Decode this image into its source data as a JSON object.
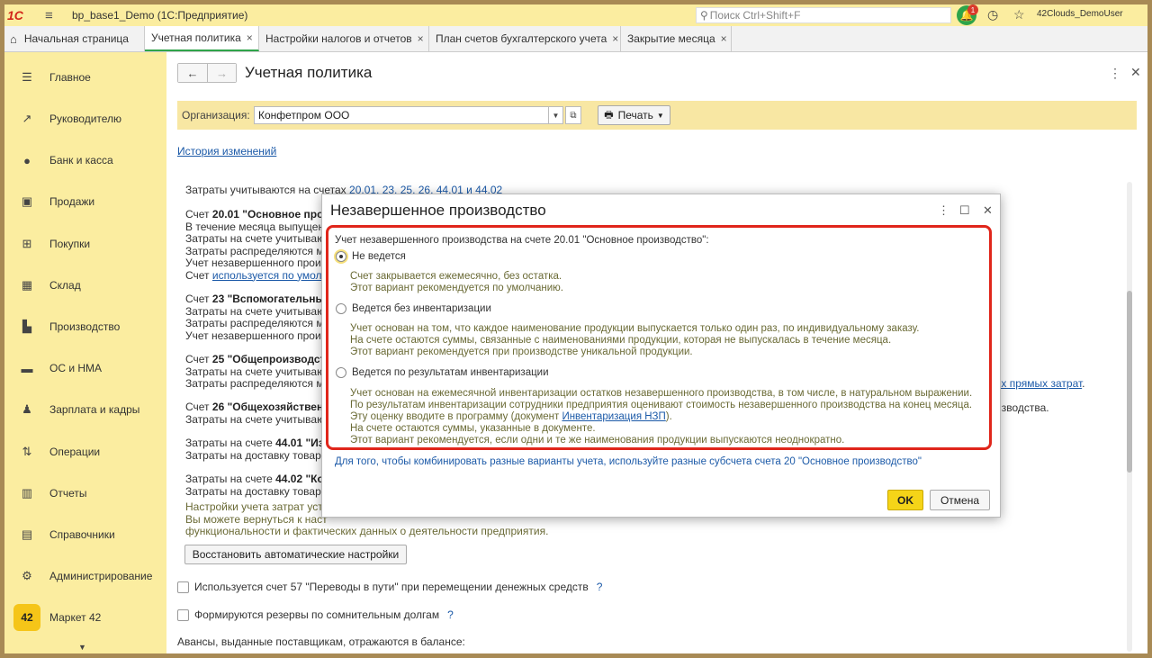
{
  "titlebar": {
    "logo": "1С",
    "app_title": "bp_base1_Demo  (1С:Предприятие)",
    "search_placeholder": "Поиск Ctrl+Shift+F",
    "notification_count": "1",
    "user": "42Clouds_DemoUser"
  },
  "tabs": [
    {
      "label": "Начальная страница"
    },
    {
      "label": "Учетная политика"
    },
    {
      "label": "Настройки налогов и отчетов"
    },
    {
      "label": "План счетов бухгалтерского учета"
    },
    {
      "label": "Закрытие месяца"
    }
  ],
  "sidebar": {
    "items": [
      {
        "label": "Главное",
        "icon": "menu-icon"
      },
      {
        "label": "Руководителю",
        "icon": "trend-icon"
      },
      {
        "label": "Банк и касса",
        "icon": "coin-icon"
      },
      {
        "label": "Продажи",
        "icon": "bag-icon"
      },
      {
        "label": "Покупки",
        "icon": "cart-icon"
      },
      {
        "label": "Склад",
        "icon": "grid-icon"
      },
      {
        "label": "Производство",
        "icon": "factory-icon"
      },
      {
        "label": "ОС и НМА",
        "icon": "truck-icon"
      },
      {
        "label": "Зарплата и кадры",
        "icon": "person-icon"
      },
      {
        "label": "Операции",
        "icon": "operations-icon"
      },
      {
        "label": "Отчеты",
        "icon": "bar-chart-icon"
      },
      {
        "label": "Справочники",
        "icon": "book-icon"
      },
      {
        "label": "Администрирование",
        "icon": "gear-icon"
      },
      {
        "label": "Маркет 42",
        "icon": "market-icon",
        "badge": "42"
      }
    ]
  },
  "page": {
    "title": "Учетная политика",
    "org_label": "Организация:",
    "org_value": "Конфетпром ООО",
    "print_label": "Печать",
    "history_link": "История изменений",
    "costs_prefix": "Затраты учитываются на счетах ",
    "costs_link": "20.01, 23, 25, 26, 44.01 и 44.02",
    "acc2001_prefix": "Счет ",
    "acc2001_bold": "20.01 \"Основное про",
    "acc2001_line1": "В течение месяца выпущен",
    "acc2001_line2": "Затраты на счете учитываю",
    "acc2001_line3": "Затраты распределяются м",
    "acc2001_line4": "Учет незавершенного произ",
    "acc2001_line5_prefix": "Счет ",
    "acc2001_line5_link": "используется по умолч",
    "acc23_prefix": "Счет ",
    "acc23_bold": "23 \"Вспомогательны",
    "acc23_line1": "Затраты на счете учитываю",
    "acc23_line2": "Затраты распределяются м",
    "acc23_line3": "Учет незавершенного произ",
    "acc25_prefix": "Счет ",
    "acc25_bold": "25 \"Общепроизводст",
    "acc25_line1": "Затраты на счете учитываю",
    "acc25_line2": "Затраты распределяются м",
    "acc25_right_link": "ех прямых затрат",
    "acc25_right_dot": ".",
    "acc26_prefix": "Счет ",
    "acc26_bold": "26 \"Общехозяйствен",
    "acc26_line1": "Затраты на счете учитываю",
    "acc26_right": "изводства.",
    "acc4401_prefix": "Затраты на счете ",
    "acc4401_bold": "44.01 \"Из",
    "acc4401_line1": "Затраты на доставку товар",
    "acc4402_prefix": "Затраты на счете ",
    "acc4402_bold": "44.02 \"Ко",
    "acc4402_line1": "Затраты на доставку товар",
    "settings_line1": "Настройки учета затрат уст",
    "settings_line2": "Вы можете вернуться к наст",
    "settings_line3": "функциональности и фактических данных о деятельности предприятия.",
    "restore_button": "Восстановить автоматические настройки",
    "cb57_label": "Используется счет 57 \"Переводы в пути\" при перемещении денежных средств",
    "cb_reserves_label": "Формируются резервы по сомнительным долгам",
    "qmark": "?",
    "advances_label": "Авансы, выданные поставщикам, отражаются в балансе:"
  },
  "modal": {
    "title": "Незавершенное производство",
    "question": "Учет незавершенного производства на счете 20.01 \"Основное производство\":",
    "options": [
      {
        "label": "Не ведется",
        "checked": true,
        "notes": [
          "Счет закрывается ежемесячно, без остатка.",
          "Этот вариант рекомендуется по умолчанию."
        ]
      },
      {
        "label": "Ведется без инвентаризации",
        "checked": false,
        "notes": [
          "Учет основан на том, что каждое наименование продукции выпускается только один раз, по индивидуальному заказу.",
          "На счете остаются суммы, связанные с наименованиями продукции, которая не выпускалась в течение месяца.",
          "Этот вариант рекомендуется при производстве уникальной продукции."
        ]
      },
      {
        "label": "Ведется по результатам инвентаризации",
        "checked": false,
        "notes": [
          "Учет основан на ежемесячной инвентаризации остатков незавершенного производства, в том числе, в натуральном выражении.",
          "По результатам инвентаризации сотрудники предприятия оценивают стоимость незавершенного производства на конец месяца.",
          "Эту оценку вводите в программу (документ ",
          "На счете остаются суммы, указанные в документе.",
          "Этот вариант рекомендуется, если одни и те же наименования продукции выпускаются неоднократно."
        ],
        "doc_link": "Инвентаризация НЗП",
        "doc_suffix": ")."
      }
    ],
    "combo_note": "Для того, чтобы комбинировать разные варианты учета, используйте разные субсчета счета 20 \"Основное производство\"",
    "ok": "OK",
    "cancel": "Отмена"
  }
}
